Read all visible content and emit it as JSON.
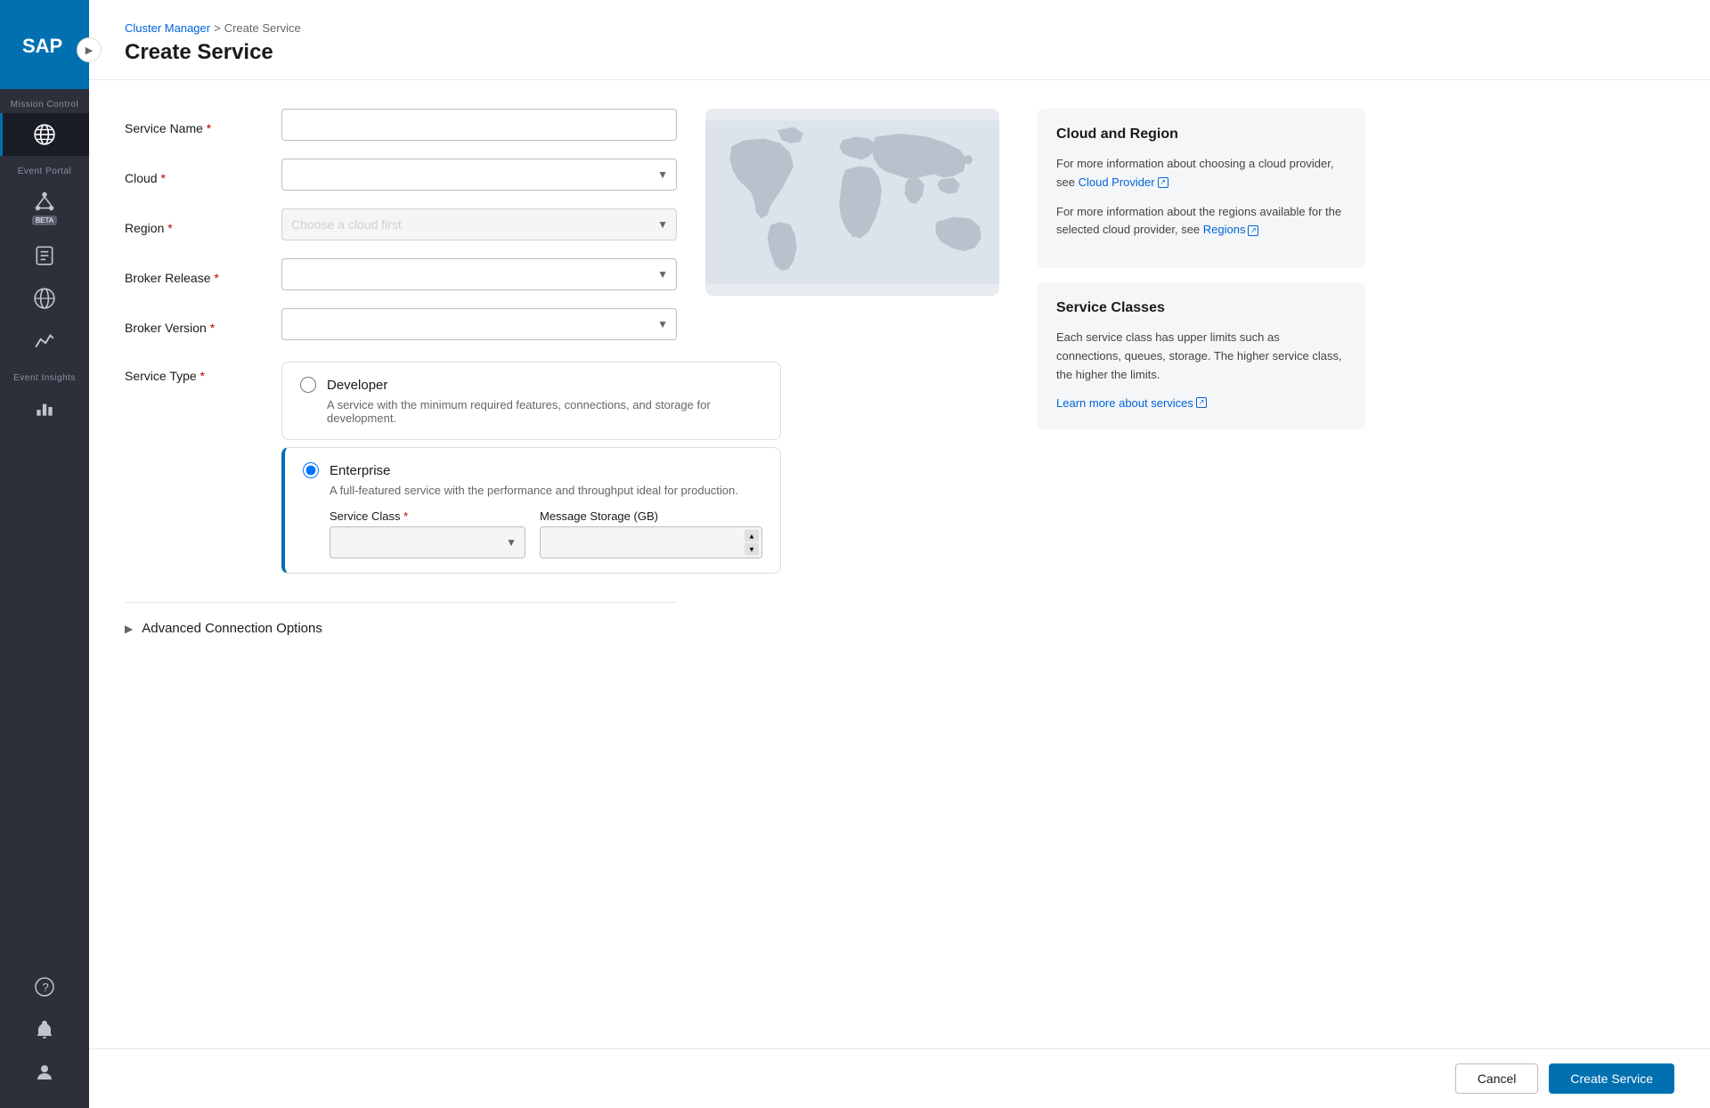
{
  "sidebar": {
    "logo_alt": "SAP Logo",
    "toggle_icon": "▶",
    "sections": [
      {
        "label": "Mission Control",
        "items": [
          {
            "id": "cluster-manager",
            "icon": "globe",
            "active": true,
            "beta": false
          },
          {
            "id": "event-portal",
            "icon": "network",
            "active": false,
            "beta": true
          }
        ]
      },
      {
        "label": "",
        "items": [
          {
            "id": "docs",
            "icon": "docs",
            "active": false,
            "beta": false
          },
          {
            "id": "global-ops",
            "icon": "globe2",
            "active": false,
            "beta": false
          },
          {
            "id": "insights",
            "icon": "chart",
            "active": false,
            "beta": false
          }
        ]
      },
      {
        "label": "Event Insights",
        "items": [
          {
            "id": "event-insights-chart",
            "icon": "bar-chart",
            "active": false,
            "beta": false
          }
        ]
      }
    ],
    "bottom_items": [
      {
        "id": "help",
        "icon": "?"
      },
      {
        "id": "notifications",
        "icon": "🔔"
      },
      {
        "id": "user",
        "icon": "👤"
      }
    ],
    "mission_control_label": "Mission Control",
    "event_portal_label": "Event Portal",
    "event_insights_label": "Event Insights"
  },
  "breadcrumb": {
    "parent": "Cluster Manager",
    "separator": ">",
    "current": "Create Service"
  },
  "page": {
    "title": "Create Service"
  },
  "form": {
    "service_name": {
      "label": "Service Name",
      "required": true,
      "placeholder": "",
      "value": ""
    },
    "cloud": {
      "label": "Cloud",
      "required": true,
      "options": [],
      "placeholder": ""
    },
    "region": {
      "label": "Region",
      "required": true,
      "placeholder": "Choose a cloud first",
      "disabled": true
    },
    "broker_release": {
      "label": "Broker Release",
      "required": true,
      "options": [],
      "placeholder": ""
    },
    "broker_version": {
      "label": "Broker Version",
      "required": true,
      "options": [],
      "placeholder": ""
    },
    "service_type": {
      "label": "Service Type",
      "required": true,
      "options": [
        {
          "id": "developer",
          "label": "Developer",
          "description": "A service with the minimum required features, connections, and storage for development.",
          "selected": false
        },
        {
          "id": "enterprise",
          "label": "Enterprise",
          "description": "A full-featured service with the performance and throughput ideal for production.",
          "selected": true,
          "extra_fields": {
            "service_class": {
              "label": "Service Class",
              "required": true,
              "options": [],
              "placeholder": ""
            },
            "message_storage": {
              "label": "Message Storage (GB)",
              "placeholder": ""
            }
          }
        }
      ]
    }
  },
  "advanced_connection": {
    "label": "Advanced Connection Options"
  },
  "info_panels": {
    "cloud_region": {
      "title": "Cloud and Region",
      "text1": "For more information about choosing a cloud provider, see ",
      "link1_label": "Cloud Provider",
      "link1_url": "#",
      "text2": "For more information about the regions available for the selected cloud provider, see ",
      "link2_label": "Regions",
      "link2_url": "#"
    },
    "service_classes": {
      "title": "Service Classes",
      "description": "Each service class has upper limits such as connections, queues, storage. The higher service class, the higher the limits.",
      "link_label": "Learn more about services",
      "link_url": "#"
    }
  },
  "footer": {
    "cancel_label": "Cancel",
    "create_label": "Create Service"
  }
}
